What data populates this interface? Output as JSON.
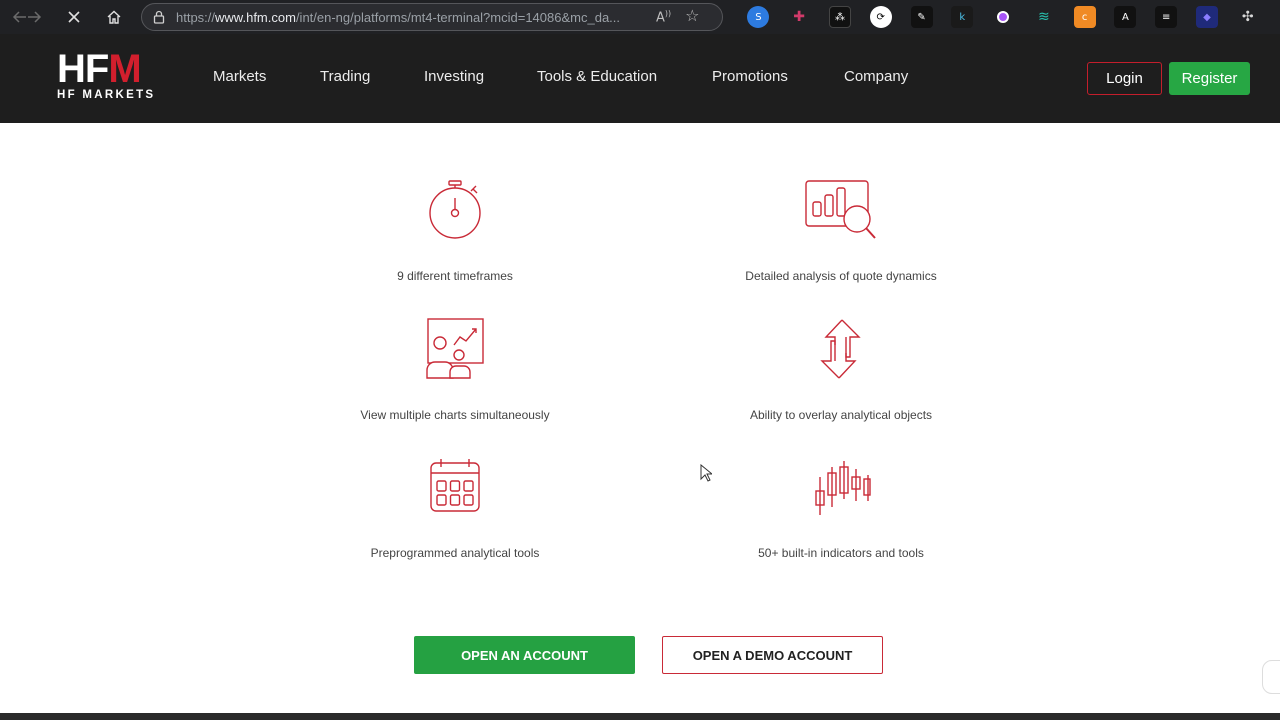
{
  "browser": {
    "url_prefix": "https://",
    "url_domain": "www.hfm.com",
    "url_path": "/int/en-ng/platforms/mt4-terminal?mcid=14086&mc_da..."
  },
  "header": {
    "logo_main_hf": "HF",
    "logo_main_m": "M",
    "logo_sub": "HF MARKETS",
    "nav": [
      "Markets",
      "Trading",
      "Investing",
      "Tools & Education",
      "Promotions",
      "Company"
    ],
    "login_label": "Login",
    "register_label": "Register"
  },
  "features": [
    {
      "label": "9 different timeframes",
      "icon": "stopwatch-icon"
    },
    {
      "label": "Detailed analysis of quote dynamics",
      "icon": "chart-magnifier-icon"
    },
    {
      "label": "View multiple charts simultaneously",
      "icon": "presentation-users-icon"
    },
    {
      "label": "Ability to overlay analytical objects",
      "icon": "up-down-arrows-icon"
    },
    {
      "label": "Preprogrammed analytical tools",
      "icon": "calendar-grid-icon"
    },
    {
      "label": "50+ built-in indicators and tools",
      "icon": "candlestick-icon"
    }
  ],
  "cta": {
    "open_account": "OPEN AN ACCOUNT",
    "open_demo": "OPEN A DEMO ACCOUNT"
  },
  "colors": {
    "brand_red": "#c92a37",
    "brand_green": "#25a142",
    "header_bg": "#1e1e1e"
  }
}
